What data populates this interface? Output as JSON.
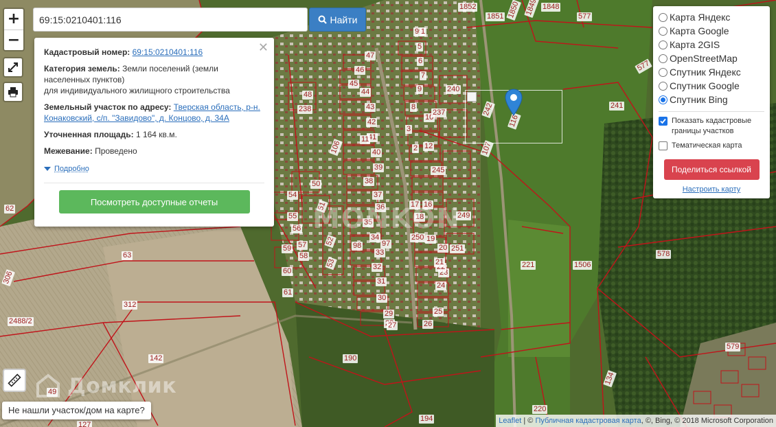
{
  "search": {
    "value": "69:15:0210401:116",
    "button_label": "Найти"
  },
  "zoom": {
    "in": "+",
    "out": "−"
  },
  "info": {
    "cadastral_label": "Кадастровый номер:",
    "cadastral_value": "69:15:0210401:116",
    "category_label": "Категория земель:",
    "category_value": "Земли поселений (земли населенных пунктов)",
    "category_use": "для индивидуального жилищного строительства",
    "address_label": "Земельный участок по адресу:",
    "address_value": "Тверская область, р-н. Конаковский, с/п. \"Завидово\", д. Концово, д. 34А",
    "area_label": "Уточненная площадь:",
    "area_value": "1 164 кв.м.",
    "survey_label": "Межевание:",
    "survey_value": "Проведено",
    "more_label": "Подробно",
    "reports_button": "Посмотреть доступные отчеты"
  },
  "layers": {
    "options": [
      {
        "label": "Карта Яндекс",
        "selected": false
      },
      {
        "label": "Карта Google",
        "selected": false
      },
      {
        "label": "Карта 2GIS",
        "selected": false
      },
      {
        "label": "OpenStreetMap",
        "selected": false
      },
      {
        "label": "Спутник Яндекс",
        "selected": false
      },
      {
        "label": "Спутник Google",
        "selected": false
      },
      {
        "label": "Спутник Bing",
        "selected": true
      }
    ],
    "show_borders_label": "Показать кадастровые границы участков",
    "show_borders_checked": true,
    "thematic_label": "Тематическая карта",
    "thematic_checked": false,
    "share_button": "Поделиться ссылкой",
    "configure_link": "Настроить карту"
  },
  "not_found_label": "Не нашли участок/дом на карте?",
  "domclick_logo": "Домклик",
  "watermark": "MONKON",
  "attribution": {
    "leaflet": "Leaflet",
    "sep1": " | © ",
    "source": "Публичная кадастровая карта",
    "rest": ", ©, Bing, © 2018 Microsoft Corporation"
  },
  "plot_labels": [
    "1852",
    "1851",
    "1850",
    "1849",
    "1848",
    "577",
    "99",
    "47",
    "46",
    "45",
    "44",
    "43",
    "42",
    "41",
    "40",
    "39",
    "38",
    "37",
    "36",
    "35",
    "34",
    "33",
    "32",
    "31",
    "30",
    "29",
    "28",
    "27",
    "26",
    "25",
    "24",
    "23",
    "22",
    "21",
    "20",
    "19",
    "18",
    "17",
    "16",
    "12",
    "10",
    "9",
    "8",
    "7",
    "6",
    "5",
    "3",
    "2",
    "1",
    "240",
    "237",
    "245",
    "249",
    "250",
    "251",
    "242",
    "116",
    "107",
    "106",
    "241",
    "577",
    "238",
    "48",
    "50",
    "51",
    "52",
    "53",
    "54",
    "55",
    "56",
    "57",
    "58",
    "59",
    "60",
    "61",
    "62",
    "63",
    "312",
    "142",
    "190",
    "194",
    "134",
    "220",
    "221",
    "1506",
    "578",
    "579",
    "2488/2",
    "49",
    "127",
    "306",
    "98",
    "97",
    "11"
  ],
  "colors": {
    "boundary": "#c0141a",
    "label_text": "#9b1c1c",
    "search_button": "#3b7fc4",
    "reports_button": "#5cb85c",
    "share_button": "#d9434e",
    "link": "#2a6ebb"
  }
}
